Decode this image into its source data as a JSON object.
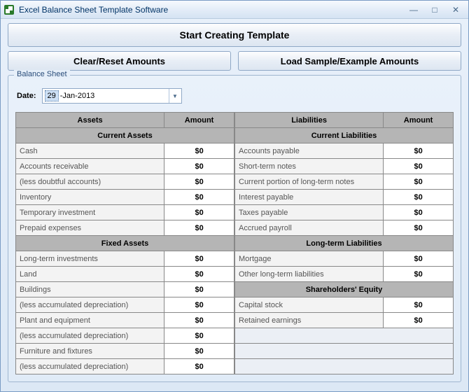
{
  "window": {
    "title": "Excel Balance Sheet Template Software"
  },
  "buttons": {
    "start": "Start Creating Template",
    "clear": "Clear/Reset Amounts",
    "load": "Load Sample/Example Amounts"
  },
  "group": {
    "title": "Balance Sheet",
    "date_label": "Date:",
    "date_day": "29",
    "date_rest": "-Jan-2013"
  },
  "left": {
    "col1": "Assets",
    "col2": "Amount",
    "section1": "Current Assets",
    "rows1": [
      {
        "label": "Cash",
        "amt": "$0"
      },
      {
        "label": "Accounts receivable",
        "amt": "$0"
      },
      {
        "label": "(less doubtful accounts)",
        "amt": "$0"
      },
      {
        "label": "Inventory",
        "amt": "$0"
      },
      {
        "label": "Temporary investment",
        "amt": "$0"
      },
      {
        "label": "Prepaid expenses",
        "amt": "$0"
      }
    ],
    "section2": "Fixed Assets",
    "rows2": [
      {
        "label": "Long-term investments",
        "amt": "$0"
      },
      {
        "label": "Land",
        "amt": "$0"
      },
      {
        "label": "Buildings",
        "amt": "$0"
      },
      {
        "label": "(less accumulated depreciation)",
        "amt": "$0"
      },
      {
        "label": "Plant and equipment",
        "amt": "$0"
      },
      {
        "label": "(less accumulated depreciation)",
        "amt": "$0"
      },
      {
        "label": "Furniture and fixtures",
        "amt": "$0"
      },
      {
        "label": "(less accumulated depreciation)",
        "amt": "$0"
      }
    ]
  },
  "right": {
    "col1": "Liabilities",
    "col2": "Amount",
    "section1": "Current Liabilities",
    "rows1": [
      {
        "label": "Accounts payable",
        "amt": "$0"
      },
      {
        "label": "Short-term notes",
        "amt": "$0"
      },
      {
        "label": "Current portion of long-term notes",
        "amt": "$0"
      },
      {
        "label": "Interest payable",
        "amt": "$0"
      },
      {
        "label": "Taxes payable",
        "amt": "$0"
      },
      {
        "label": "Accrued payroll",
        "amt": "$0"
      }
    ],
    "section2": "Long-term Liabilities",
    "rows2": [
      {
        "label": "Mortgage",
        "amt": "$0"
      },
      {
        "label": "Other long-term liabilities",
        "amt": "$0"
      }
    ],
    "section3": "Shareholders' Equity",
    "rows3": [
      {
        "label": "Capital stock",
        "amt": "$0"
      },
      {
        "label": "Retained earnings",
        "amt": "$0"
      }
    ]
  }
}
